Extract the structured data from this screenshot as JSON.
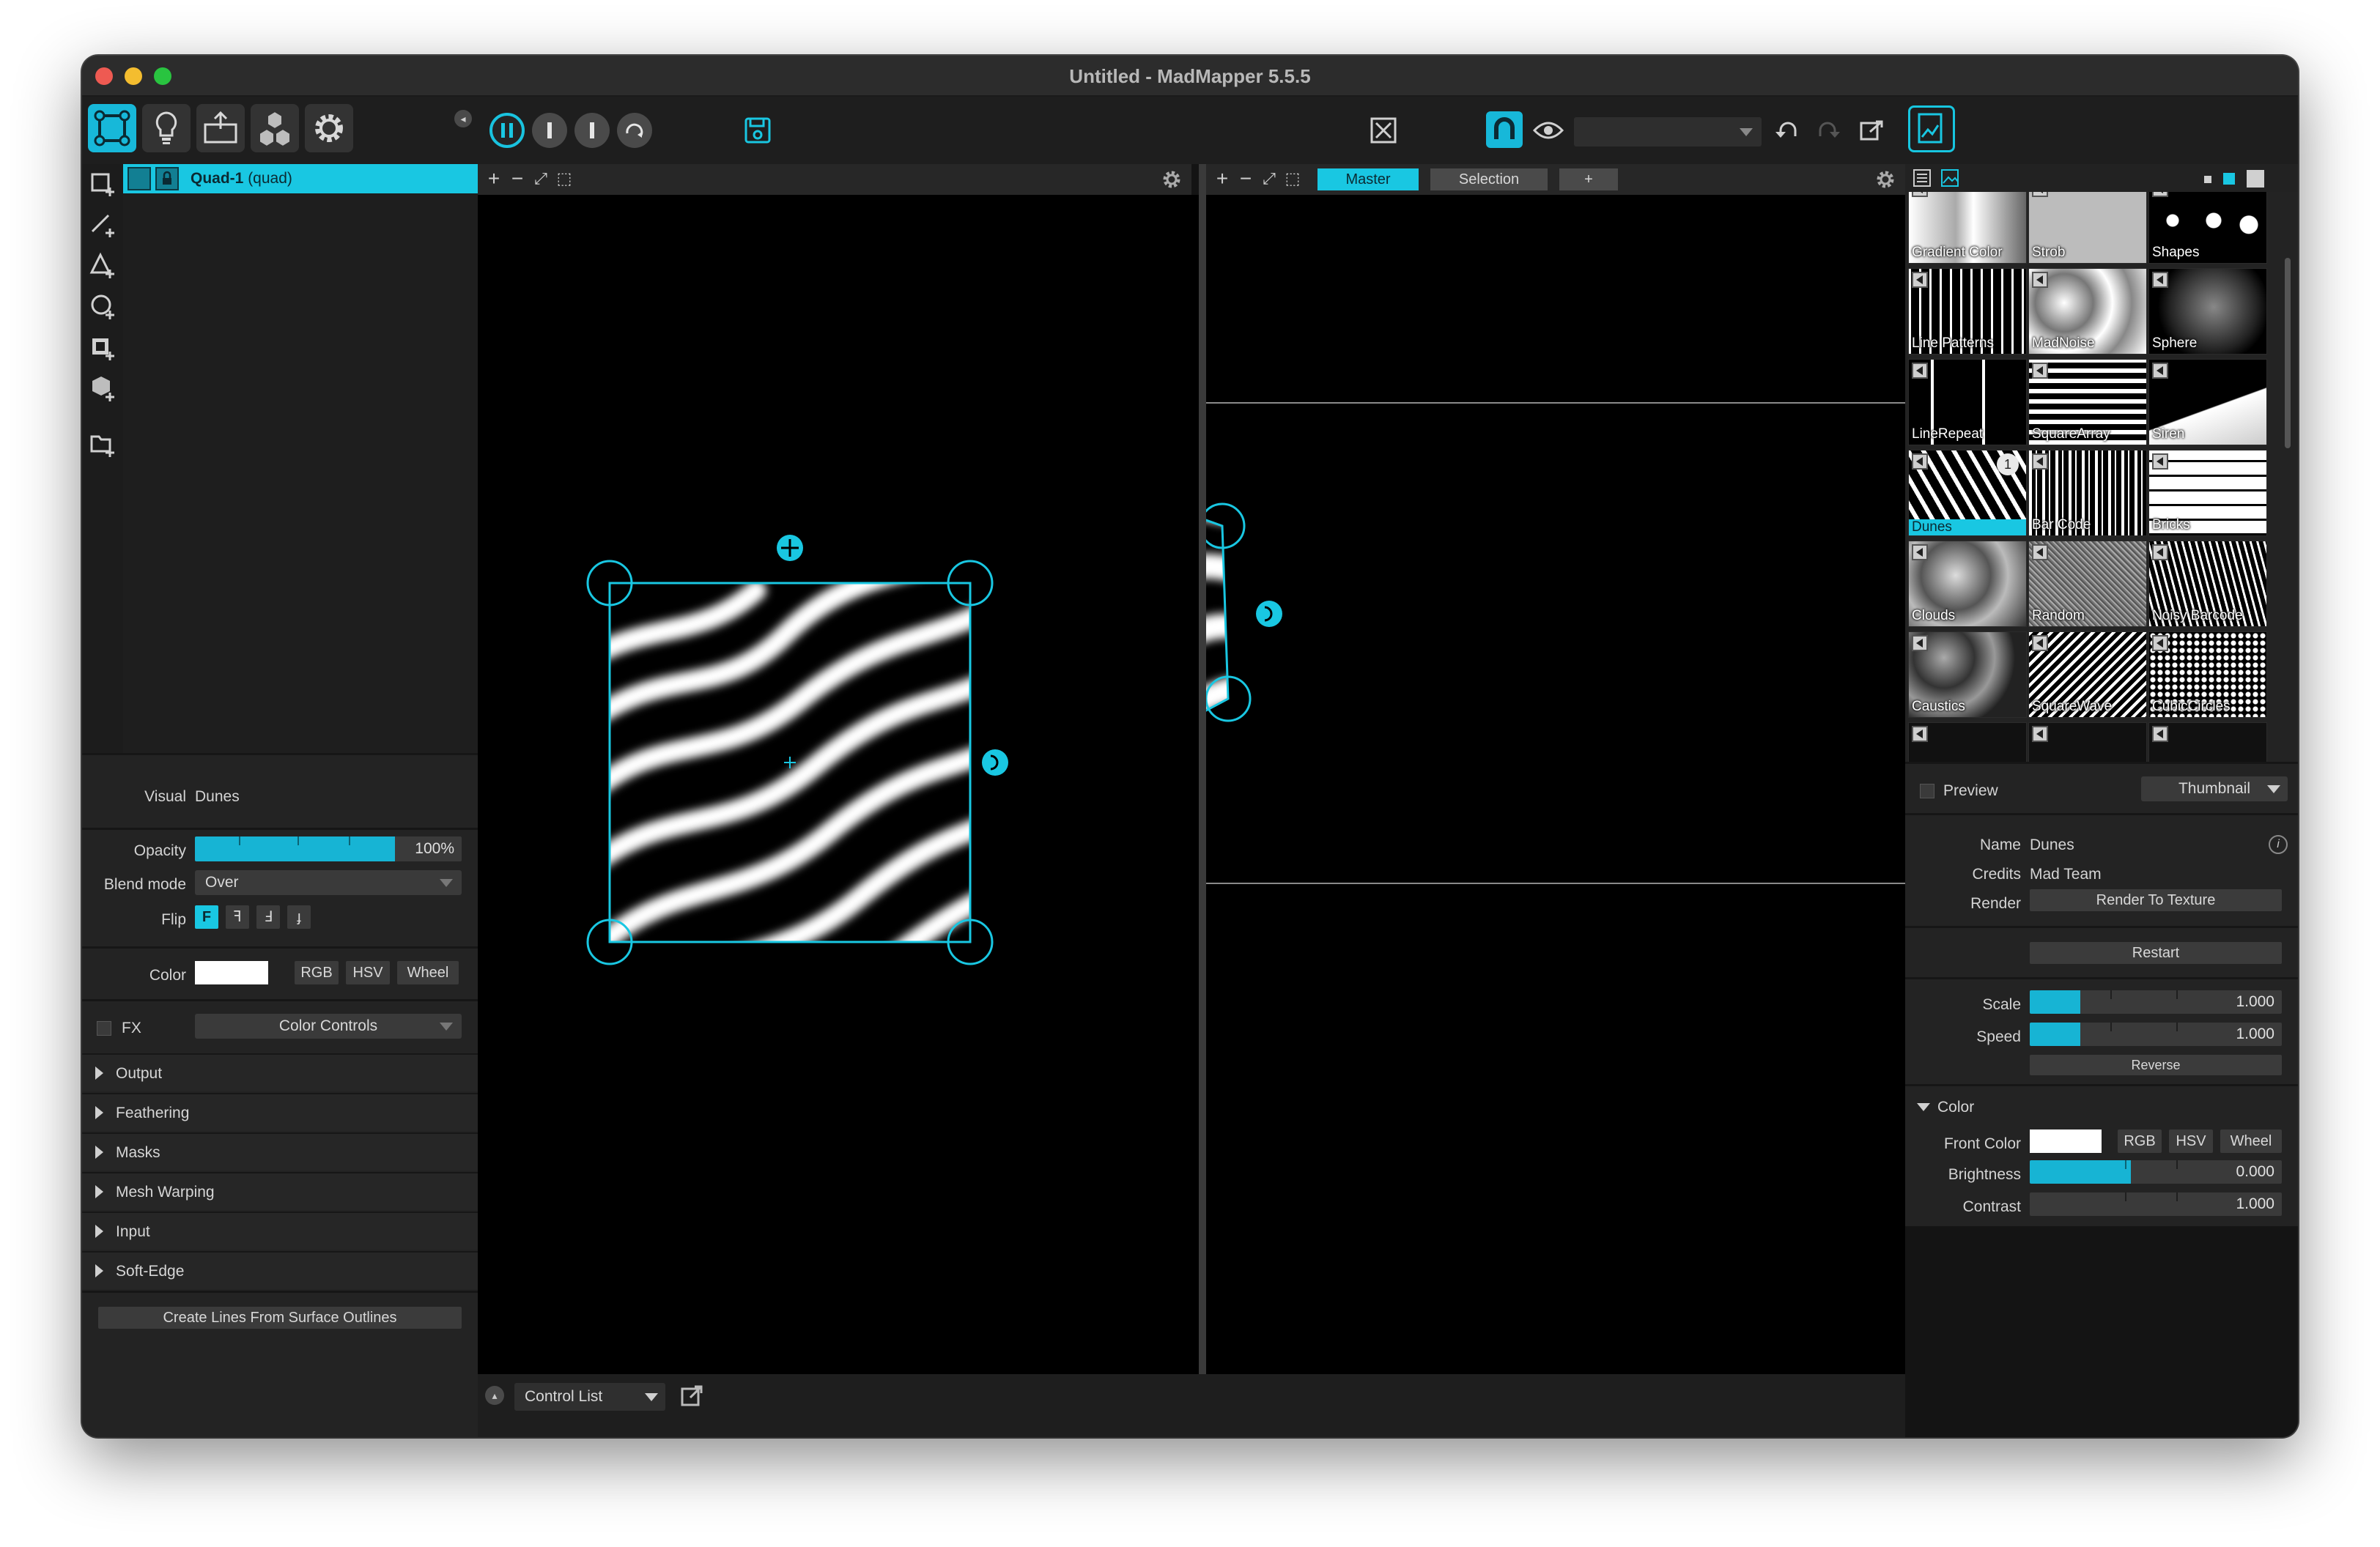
{
  "window": {
    "title": "Untitled - MadMapper 5.5.5"
  },
  "colors": {
    "accent": "#19c7e2",
    "background": "#000000",
    "panel": "#232323"
  },
  "toolbar": {
    "left_icons": [
      "surface-mode-icon",
      "light-bulb-icon",
      "output-icon",
      "cubes-icon",
      "gear-icon"
    ],
    "transport_icons": [
      "pause-icon",
      "stop-icon",
      "stop-icon",
      "reload-icon"
    ],
    "save_icon": "save-icon",
    "fullscreen_icon": "fullscreen-icon",
    "magnet_icon": "magnet-icon",
    "eye_icon": "eye-icon",
    "undo_icon": "undo-icon",
    "redo_icon": "redo-icon",
    "export_icon": "export-icon",
    "preview_icon": "chart-preview-icon"
  },
  "surfaces": {
    "items": [
      {
        "name": "Quad-1",
        "type": "(quad)"
      }
    ]
  },
  "properties": {
    "visual_label": "Visual",
    "visual_value": "Dunes",
    "opacity_label": "Opacity",
    "opacity": {
      "value": "100%",
      "level": 1.0
    },
    "blend_label": "Blend mode",
    "blend_value": "Over",
    "flip_label": "Flip",
    "flip_buttons": [
      "F",
      "ꟻ",
      "Ⅎ",
      "ɟ"
    ],
    "color_label": "Color",
    "color_value": "#ffffff",
    "color_modes": [
      "RGB",
      "HSV",
      "Wheel"
    ],
    "fx_label": "FX",
    "fx_value": "Color Controls",
    "sections": [
      "Output",
      "Feathering",
      "Masks",
      "Mesh Warping",
      "Input",
      "Soft-Edge"
    ],
    "create_lines_label": "Create Lines From Surface Outlines"
  },
  "input_view": {
    "toolbar": [
      "+",
      "−",
      "⤢",
      "⬚"
    ]
  },
  "output_view": {
    "toolbar": [
      "+",
      "−",
      "⤢",
      "⬚"
    ],
    "tabs": [
      "Master",
      "Selection",
      "+"
    ]
  },
  "library": {
    "thumbs": [
      {
        "label": "Gradient Color"
      },
      {
        "label": "Strob"
      },
      {
        "label": "Shapes"
      },
      {
        "label": "Line Patterns"
      },
      {
        "label": "MadNoise"
      },
      {
        "label": "Sphere"
      },
      {
        "label": "LineRepeat"
      },
      {
        "label": "SquareArray"
      },
      {
        "label": "Siren"
      },
      {
        "label": "Dunes",
        "badge": "1"
      },
      {
        "label": "Bar Code"
      },
      {
        "label": "Bricks"
      },
      {
        "label": "Clouds"
      },
      {
        "label": "Random"
      },
      {
        "label": "Noisy Barcode"
      },
      {
        "label": "Caustics"
      },
      {
        "label": "SquareWave"
      },
      {
        "label": "CubicCircles"
      }
    ]
  },
  "inspector": {
    "preview_label": "Preview",
    "preview_mode": "Thumbnail",
    "name_label": "Name",
    "name_value": "Dunes",
    "credits_label": "Credits",
    "credits_value": "Mad Team",
    "render_label": "Render",
    "render_button": "Render  To Texture",
    "restart_button": "Restart",
    "scale_label": "Scale",
    "scale": {
      "value": "1.000",
      "level": 0.2
    },
    "speed_label": "Speed",
    "speed": {
      "value": "1.000",
      "level": 0.2
    },
    "reverse_button": "Reverse",
    "color_section": "Color",
    "front_color_label": "Front Color",
    "front_color_value": "#ffffff",
    "color_modes": [
      "RGB",
      "HSV",
      "Wheel"
    ],
    "brightness_label": "Brightness",
    "brightness": {
      "value": "0.000",
      "level": 0.4
    },
    "contrast_label": "Contrast",
    "contrast": {
      "value": "1.000",
      "level": 0.0
    }
  },
  "bottom": {
    "control_list": "Control List"
  }
}
